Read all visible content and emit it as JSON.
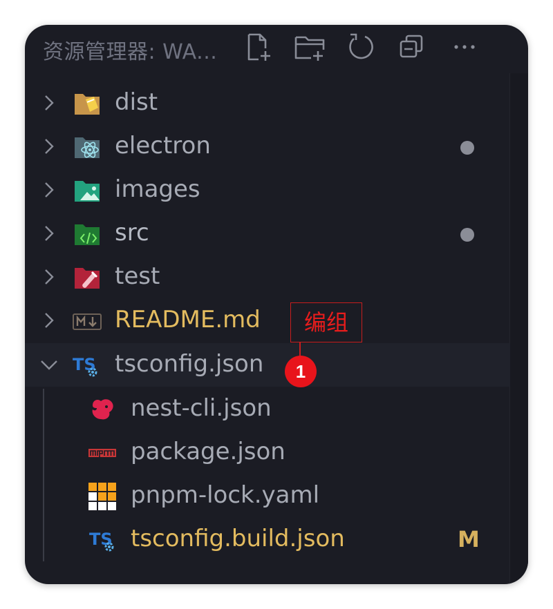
{
  "header": {
    "title": "资源管理器: WA...",
    "actions": [
      {
        "icon": "new-file-icon"
      },
      {
        "icon": "new-folder-icon"
      },
      {
        "icon": "refresh-icon"
      },
      {
        "icon": "collapse-all-icon"
      },
      {
        "icon": "more-actions-icon"
      }
    ]
  },
  "tree": [
    {
      "name": "dist",
      "type": "folder",
      "icon": "folder-dist-icon",
      "color": "#6b6e7a"
    },
    {
      "name": "electron",
      "type": "folder",
      "icon": "folder-electron-icon",
      "color": "#b4b8c2",
      "status": "dot"
    },
    {
      "name": "images",
      "type": "folder",
      "icon": "folder-images-icon",
      "color": "#a7abb5"
    },
    {
      "name": "src",
      "type": "folder",
      "icon": "folder-src-icon",
      "color": "#b4b8c2",
      "status": "dot"
    },
    {
      "name": "test",
      "type": "folder",
      "icon": "folder-test-icon",
      "color": "#a7abb5"
    },
    {
      "name": "README.md",
      "type": "file",
      "icon": "markdown-icon",
      "color": "#e3bb5f"
    },
    {
      "name": "tsconfig.json",
      "type": "file-group",
      "expanded": true,
      "icon": "tsconfig-icon",
      "color": "#a7abb5"
    },
    {
      "name": "nest-cli.json",
      "type": "file",
      "icon": "nestjs-icon",
      "color": "#a7abb5"
    },
    {
      "name": "package.json",
      "type": "file",
      "icon": "npm-icon",
      "color": "#a7abb5"
    },
    {
      "name": "pnpm-lock.yaml",
      "type": "file",
      "icon": "pnpm-icon",
      "color": "#a7abb5"
    },
    {
      "name": "tsconfig.build.json",
      "type": "file",
      "icon": "tsconfig-icon",
      "color": "#e3bb5f",
      "git_status": "M"
    }
  ],
  "annotation": {
    "label": "编组",
    "badge": "1"
  }
}
